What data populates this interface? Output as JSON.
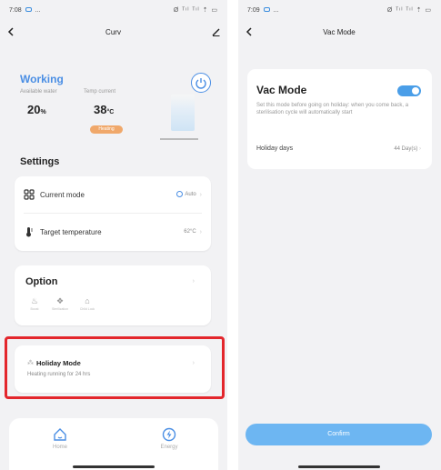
{
  "left_phone": {
    "status_bar": {
      "time": "7:08",
      "dots": "...",
      "icons": "Ø ᵀᶦˡ ᵀᶦˡ ⇡ ▭"
    },
    "nav": {
      "title": "Curv"
    },
    "status": {
      "state": "Working",
      "available_water_label": "Available water",
      "available_water_value": "20",
      "available_water_unit": "%",
      "temp_current_label": "Temp current",
      "temp_current_value": "38",
      "temp_current_unit": "°C",
      "heating_badge": "Heating"
    },
    "settings": {
      "title": "Settings",
      "current_mode_label": "Current mode",
      "current_mode_value": "Auto",
      "target_temp_label": "Target temperature",
      "target_temp_value": "62°C"
    },
    "option": {
      "title": "Option",
      "items": [
        {
          "label": "Boost"
        },
        {
          "label": "Sterilization"
        },
        {
          "label": "Child Lock"
        }
      ]
    },
    "holiday": {
      "title": "Holiday Mode",
      "subtitle": "Heating running for 24 hrs"
    },
    "tabs": [
      {
        "label": "Home"
      },
      {
        "label": "Energy"
      }
    ],
    "colors": {
      "accent": "#4a8ee4",
      "heating": "#f0a86a",
      "highlight": "#e3262c"
    }
  },
  "right_phone": {
    "status_bar": {
      "time": "7:09",
      "dots": "...",
      "icons": "Ø ᵀᶦˡ ᵀᶦˡ ⇡ ▭"
    },
    "nav": {
      "title": "Vac Mode"
    },
    "vac": {
      "title": "Vac Mode",
      "toggle_on": true,
      "description": "Set this mode before going on holiday: when you come back, a sterilisation cycle will automatically start",
      "holiday_days_label": "Holiday days",
      "holiday_days_value": "44 Day(s)"
    },
    "confirm_label": "Confirm",
    "colors": {
      "toggle": "#4a9ee8",
      "confirm": "#6db6f2"
    }
  }
}
